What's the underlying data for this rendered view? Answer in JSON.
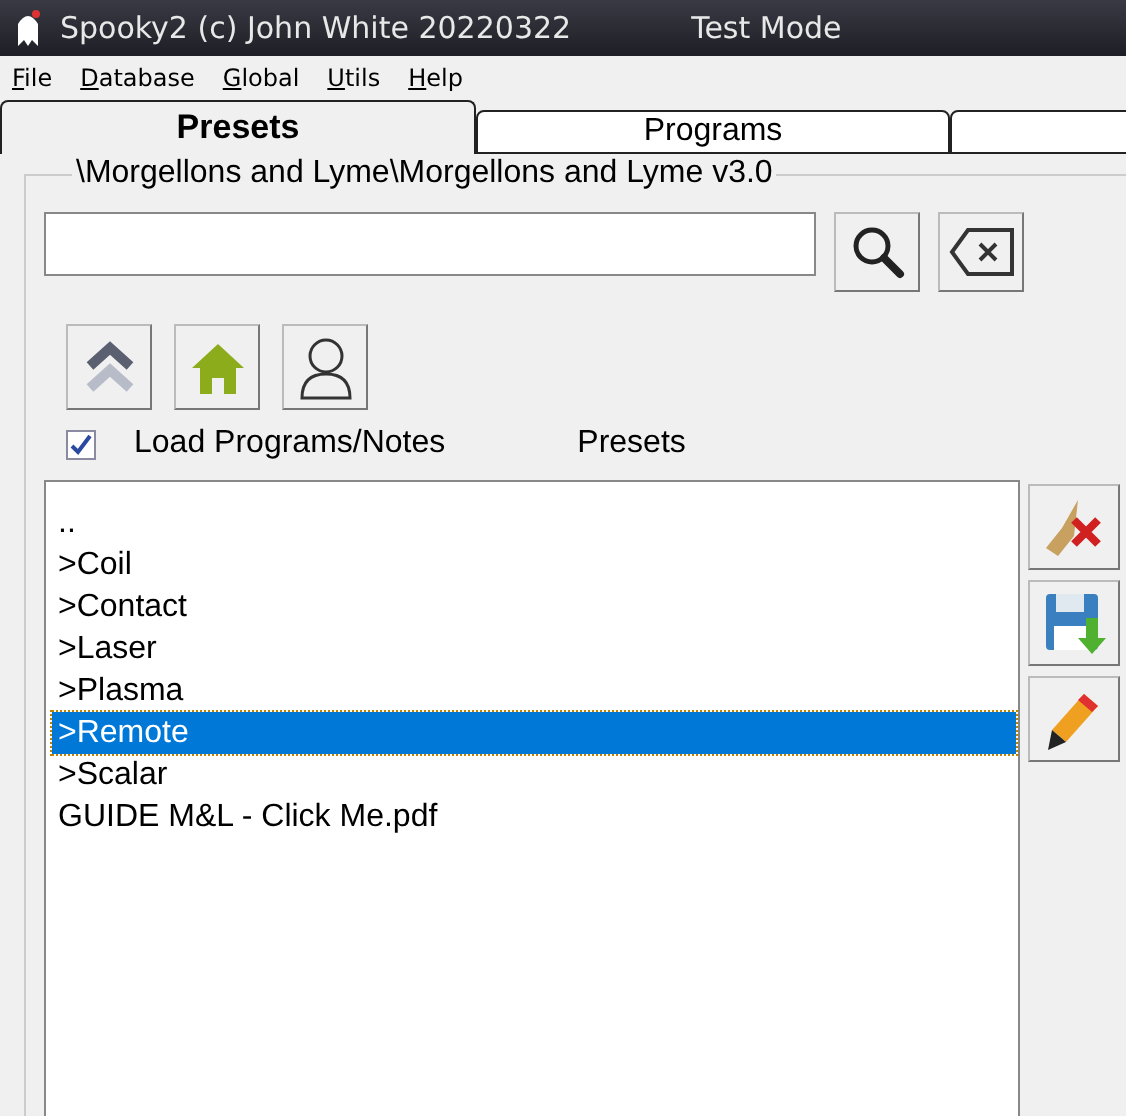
{
  "window": {
    "title": "Spooky2 (c) John White 20220322",
    "mode": "Test Mode"
  },
  "menu": [
    "File",
    "Database",
    "Global",
    "Utils",
    "Help"
  ],
  "tabs": [
    {
      "label": "Presets",
      "selected": true
    },
    {
      "label": "Programs",
      "selected": false
    },
    {
      "selected": false
    }
  ],
  "path": "\\Morgellons and Lyme\\Morgellons and Lyme v3.0",
  "load_programs": {
    "label": "Load Programs/Notes",
    "checked": true
  },
  "list_title": "Presets",
  "items": [
    {
      "label": "..",
      "selected": false
    },
    {
      "label": ">Coil",
      "selected": false
    },
    {
      "label": ">Contact",
      "selected": false
    },
    {
      "label": ">Laser",
      "selected": false
    },
    {
      "label": ">Plasma",
      "selected": false
    },
    {
      "label": ">Remote",
      "selected": true
    },
    {
      "label": ">Scalar",
      "selected": false
    },
    {
      "label": "GUIDE M&L - Click Me.pdf",
      "selected": false
    }
  ]
}
